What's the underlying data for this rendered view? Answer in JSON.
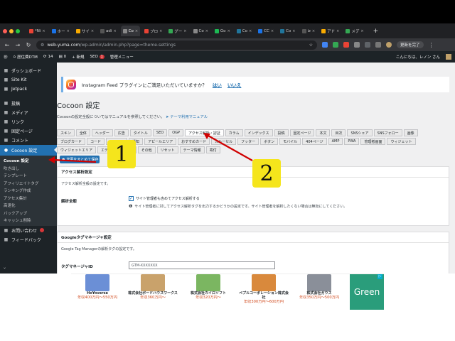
{
  "browser": {
    "tabs": [
      {
        "icon": "gmail-icon",
        "label": "*Ni",
        "color": "#ea4335"
      },
      {
        "icon": "site-icon",
        "label": "ホー",
        "color": "#1a73e8"
      },
      {
        "icon": "site-icon",
        "label": "サイ",
        "color": "#f9ab00"
      },
      {
        "icon": "site-icon",
        "label": "adi",
        "color": "#555"
      },
      {
        "icon": "site-icon",
        "label": "Co",
        "color": "#888",
        "active": true
      },
      {
        "icon": "site-icon",
        "label": "プロ",
        "color": "#ea4335"
      },
      {
        "icon": "site-icon",
        "label": "グー",
        "color": "#34a853"
      },
      {
        "icon": "site-icon",
        "label": "Co",
        "color": "#888"
      },
      {
        "icon": "site-icon",
        "label": "Go",
        "color": "#1db954"
      },
      {
        "icon": "site-icon",
        "label": "Co",
        "color": "#21759b"
      },
      {
        "icon": "site-icon",
        "label": "CC",
        "color": "#1a73e8"
      },
      {
        "icon": "site-icon",
        "label": "Co",
        "color": "#21759b"
      },
      {
        "icon": "site-icon",
        "label": "iz",
        "color": "#555"
      },
      {
        "icon": "site-icon",
        "label": "アド",
        "color": "#f9ab00"
      },
      {
        "icon": "site-icon",
        "label": "メデ",
        "color": "#34a853"
      }
    ],
    "new_tab": "+",
    "url": "web-yuma.com",
    "url_path": "/wp-admin/admin.php?page=theme-settings",
    "relaunch_label": "更新を完了"
  },
  "wp_toolbar": {
    "site_name": "居住費DTM",
    "updates": "14",
    "comments": "0",
    "new": "+ 新規",
    "seo": "SEO",
    "seo_badge": "1",
    "manage_menu": "管理メニュー",
    "greeting": "こんにちは、レノン さん"
  },
  "sidebar": {
    "items_top": [
      {
        "label": "ダッシュボード",
        "icon": "dashboard-icon"
      },
      {
        "label": "Site Kit",
        "icon": "sitekit-icon"
      },
      {
        "label": "Jetpack",
        "icon": "jetpack-icon"
      }
    ],
    "items_mid": [
      {
        "label": "投稿",
        "icon": "pin-icon"
      },
      {
        "label": "メディア",
        "icon": "media-icon"
      },
      {
        "label": "リンク",
        "icon": "link-icon"
      },
      {
        "label": "固定ページ",
        "icon": "page-icon"
      },
      {
        "label": "コメント",
        "icon": "comment-icon"
      }
    ],
    "current": "Cocoon 設定",
    "submenu": [
      "Cocoon 設定",
      "吹き出し",
      "テンプレート",
      "アフィリエイトタグ",
      "ランキング作成",
      "アクセス集計",
      "高速化",
      "バックアップ",
      "キャッシュ削除"
    ],
    "items_bottom": [
      {
        "label": "お問い合わせ",
        "icon": "mail-icon"
      },
      {
        "label": "フィードバック",
        "icon": "feedback-icon"
      }
    ]
  },
  "notice": {
    "text": "Instagram Feed プラグインにご満足いただいていますか？",
    "yes": "はい",
    "no": "いいえ"
  },
  "page": {
    "title": "Cocoon 設定",
    "desc": "Cocoonの設定全般についてはマニュアルを参照してください。",
    "manual_link": "テーマ利用マニュアル"
  },
  "settings_tabs": [
    "スキン",
    "全体",
    "ヘッダー",
    "広告",
    "タイトル",
    "SEO",
    "OGP",
    "アクセス解析・認証",
    "カラム",
    "インデックス",
    "投稿",
    "固定ページ",
    "本文",
    "目次",
    "SNSシェア",
    "SNSフォロー",
    "画像",
    "ブログカード",
    "コード",
    "コメント",
    "通知",
    "アピールエリア",
    "おすすめカード",
    "カルーセル",
    "フッター",
    "ボタン",
    "モバイル",
    "404ページ",
    "AMP",
    "PWA",
    "管理者画面",
    "ウィジェット",
    "ウィジェットエリア",
    "エディター",
    "API",
    "その他",
    "リセット",
    "テーマ情報",
    "寄付"
  ],
  "active_tab": "アクセス解析・認証",
  "save_button": "変更をまとめて保存",
  "access_panel": {
    "title": "アクセス解析設定",
    "desc": "アクセス解析全般の設定です。",
    "field_label": "解析全般",
    "checkbox_label": "サイト管理者も含めてアクセス解析する",
    "checkbox_checked": true,
    "help": "サイト管理者に対してアクセス解析タグを出力するかどうかの設定です。サイト管理者を解析したくない場合は無効にしてください。"
  },
  "gtm_panel": {
    "title": "Googleタグマネージャ設定",
    "desc": "Google Tag Managerの解析タグの設定です。",
    "field_label": "タグマネージャID",
    "placeholder": "GTM-XXXXXXX"
  },
  "ads": [
    {
      "name": "HoYoverse",
      "salary": "年収400万円〜550万円",
      "color": "#6b8fd6"
    },
    {
      "name": "株式会社ボードハウスワークス",
      "salary": "年収360万円〜",
      "color": "#c9a26b"
    },
    {
      "name": "株式会社カイロソフト",
      "salary": "年収320万円〜",
      "color": "#7bb661"
    },
    {
      "name": "ペプルコーポレーション株式会社",
      "salary": "年収300万円〜600万円",
      "color": "#d9893c"
    },
    {
      "name": "株式会社ガウス",
      "salary": "年収350万円〜500万円",
      "color": "#8a8f99"
    }
  ],
  "green_ad": "Green",
  "callouts": [
    "1",
    "2"
  ]
}
